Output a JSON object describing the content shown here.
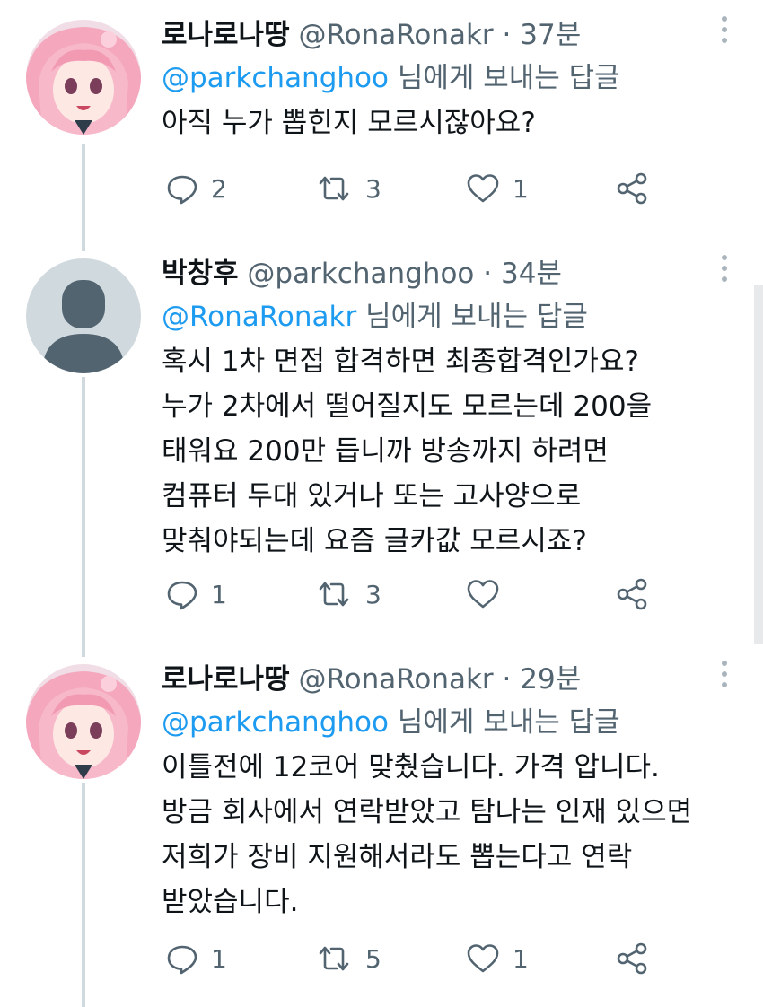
{
  "tweets": [
    {
      "name": "로나로나땅",
      "handle": "@RonaRonakr",
      "dot": "·",
      "time": "37분",
      "reply_mention": "@parkchanghoo",
      "reply_suffix": " 님에게 보내는 답글",
      "lines": [
        "아직 누가 뽑힌지 모르시잖아요?"
      ],
      "reply_count": "2",
      "retweet_count": "3",
      "like_count": "1",
      "avatar": "anime-girl-pink-hair"
    },
    {
      "name": "박창후",
      "handle": "@parkchanghoo",
      "dot": "·",
      "time": "34분",
      "reply_mention": "@RonaRonakr",
      "reply_suffix": " 님에게 보내는 답글",
      "lines": [
        "혹시 1차 면접 합격하면 최종합격인가요?",
        "누가 2차에서 떨어질지도 모르는데 200을",
        "태워요 200만 듭니까 방송까지 하려면",
        "컴퓨터 두대 있거나 또는 고사양으로",
        "맞춰야되는데 요즘 글카값 모르시죠?"
      ],
      "reply_count": "1",
      "retweet_count": "3",
      "like_count": "",
      "avatar": "default-person"
    },
    {
      "name": "로나로나땅",
      "handle": "@RonaRonakr",
      "dot": "·",
      "time": "29분",
      "reply_mention": "@parkchanghoo",
      "reply_suffix": " 님에게 보내는 답글",
      "lines": [
        "이틀전에 12코어 맞췄습니다. 가격 압니다.",
        "방금 회사에서 연락받았고 탐나는 인재 있으면",
        "저희가 장비 지원해서라도 뽑는다고 연락",
        "받았습니다."
      ],
      "reply_count": "1",
      "retweet_count": "5",
      "like_count": "1",
      "avatar": "anime-girl-pink-hair"
    }
  ],
  "icons": [
    "reply-icon",
    "retweet-icon",
    "like-icon",
    "share-icon",
    "more-icon"
  ],
  "colors": {
    "mention": "#1d9bf0",
    "secondary_text": "#536471",
    "primary_text": "#0f1419",
    "thread_line": "#cfd9de"
  }
}
